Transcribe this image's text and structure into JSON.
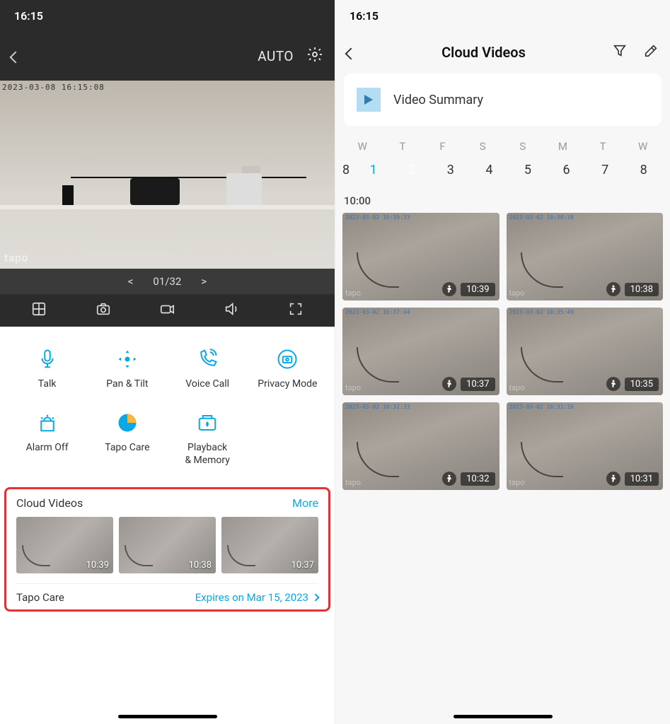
{
  "status": {
    "time": "16:15"
  },
  "left": {
    "header": {
      "mode": "AUTO"
    },
    "live": {
      "timestamp": "2023-03-08 16:15:08",
      "watermark": "tapo"
    },
    "pager": {
      "current": "01",
      "total": "32"
    },
    "actions": [
      {
        "label": "Talk"
      },
      {
        "label": "Pan & Tilt"
      },
      {
        "label": "Voice Call"
      },
      {
        "label": "Privacy Mode"
      },
      {
        "label": "Alarm Off"
      },
      {
        "label": "Tapo Care"
      },
      {
        "label": "Playback\n& Memory"
      }
    ],
    "cloud": {
      "title": "Cloud Videos",
      "more": "More",
      "thumbs": [
        {
          "time": "10:39"
        },
        {
          "time": "10:38"
        },
        {
          "time": "10:37"
        }
      ],
      "care_label": "Tapo Care",
      "care_expiry": "Expires on Mar 15, 2023"
    }
  },
  "right": {
    "title": "Cloud Videos",
    "summary": "Video Summary",
    "calendar": {
      "days": [
        "W",
        "T",
        "F",
        "S",
        "S",
        "M",
        "T",
        "W"
      ],
      "dates_cutoff": "8",
      "dates": [
        "1",
        "2",
        "3",
        "4",
        "5",
        "6",
        "7",
        "8"
      ],
      "active_index": 1,
      "past_index": 0
    },
    "section_time": "10:00",
    "clips": [
      {
        "ts": "2023-03-02 10:39:33",
        "time": "10:39"
      },
      {
        "ts": "2023-03-02 10:38:38",
        "time": "10:38"
      },
      {
        "ts": "2023-03-02 10:37:44",
        "time": "10:37"
      },
      {
        "ts": "2023-03-02 10:35:49",
        "time": "10:35"
      },
      {
        "ts": "2023-03-02 10:32:33",
        "time": "10:32"
      },
      {
        "ts": "2023-03-02 10:31:16",
        "time": "10:31"
      }
    ],
    "watermark": "tapo"
  }
}
